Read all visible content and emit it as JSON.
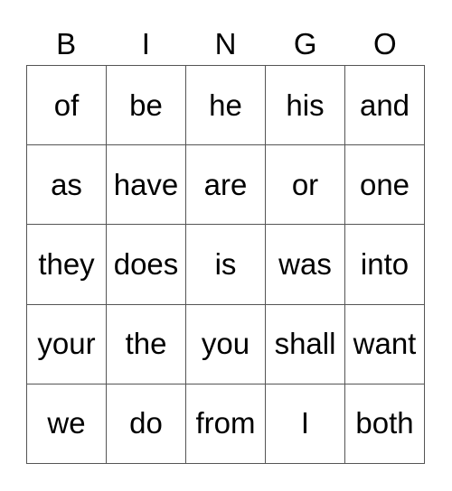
{
  "header": [
    "B",
    "I",
    "N",
    "G",
    "O"
  ],
  "rows": [
    [
      "of",
      "be",
      "he",
      "his",
      "and"
    ],
    [
      "as",
      "have",
      "are",
      "or",
      "one"
    ],
    [
      "they",
      "does",
      "is",
      "was",
      "into"
    ],
    [
      "your",
      "the",
      "you",
      "shall",
      "want"
    ],
    [
      "we",
      "do",
      "from",
      "I",
      "both"
    ]
  ]
}
